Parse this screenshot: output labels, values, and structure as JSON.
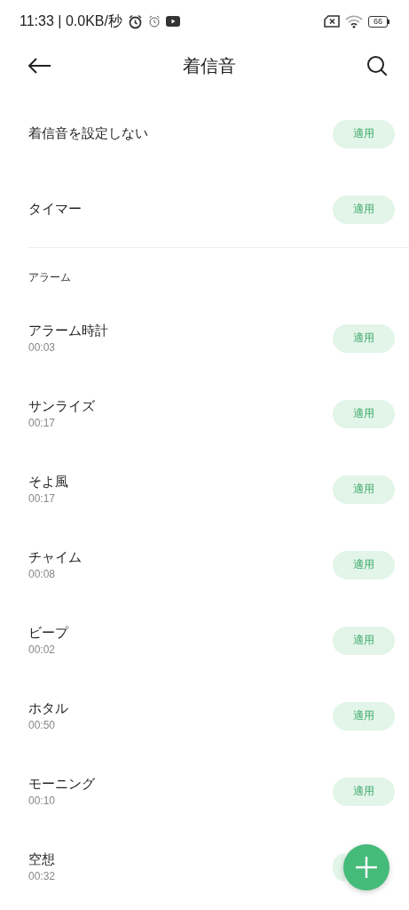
{
  "status_bar": {
    "time": "11:33 | 0.0KB/秒",
    "battery": "66"
  },
  "header": {
    "title": "着信音"
  },
  "top_items": [
    {
      "title": "着信音を設定しない",
      "button": "適用"
    },
    {
      "title": "タイマー",
      "button": "適用"
    }
  ],
  "section": {
    "label": "アラーム",
    "items": [
      {
        "title": "アラーム時計",
        "duration": "00:03",
        "button": "適用"
      },
      {
        "title": "サンライズ",
        "duration": "00:17",
        "button": "適用"
      },
      {
        "title": "そよ風",
        "duration": "00:17",
        "button": "適用"
      },
      {
        "title": "チャイム",
        "duration": "00:08",
        "button": "適用"
      },
      {
        "title": "ビープ",
        "duration": "00:02",
        "button": "適用"
      },
      {
        "title": "ホタル",
        "duration": "00:50",
        "button": "適用"
      },
      {
        "title": "モーニング",
        "duration": "00:10",
        "button": "適用"
      },
      {
        "title": "空想",
        "duration": "00:32"
      }
    ]
  }
}
